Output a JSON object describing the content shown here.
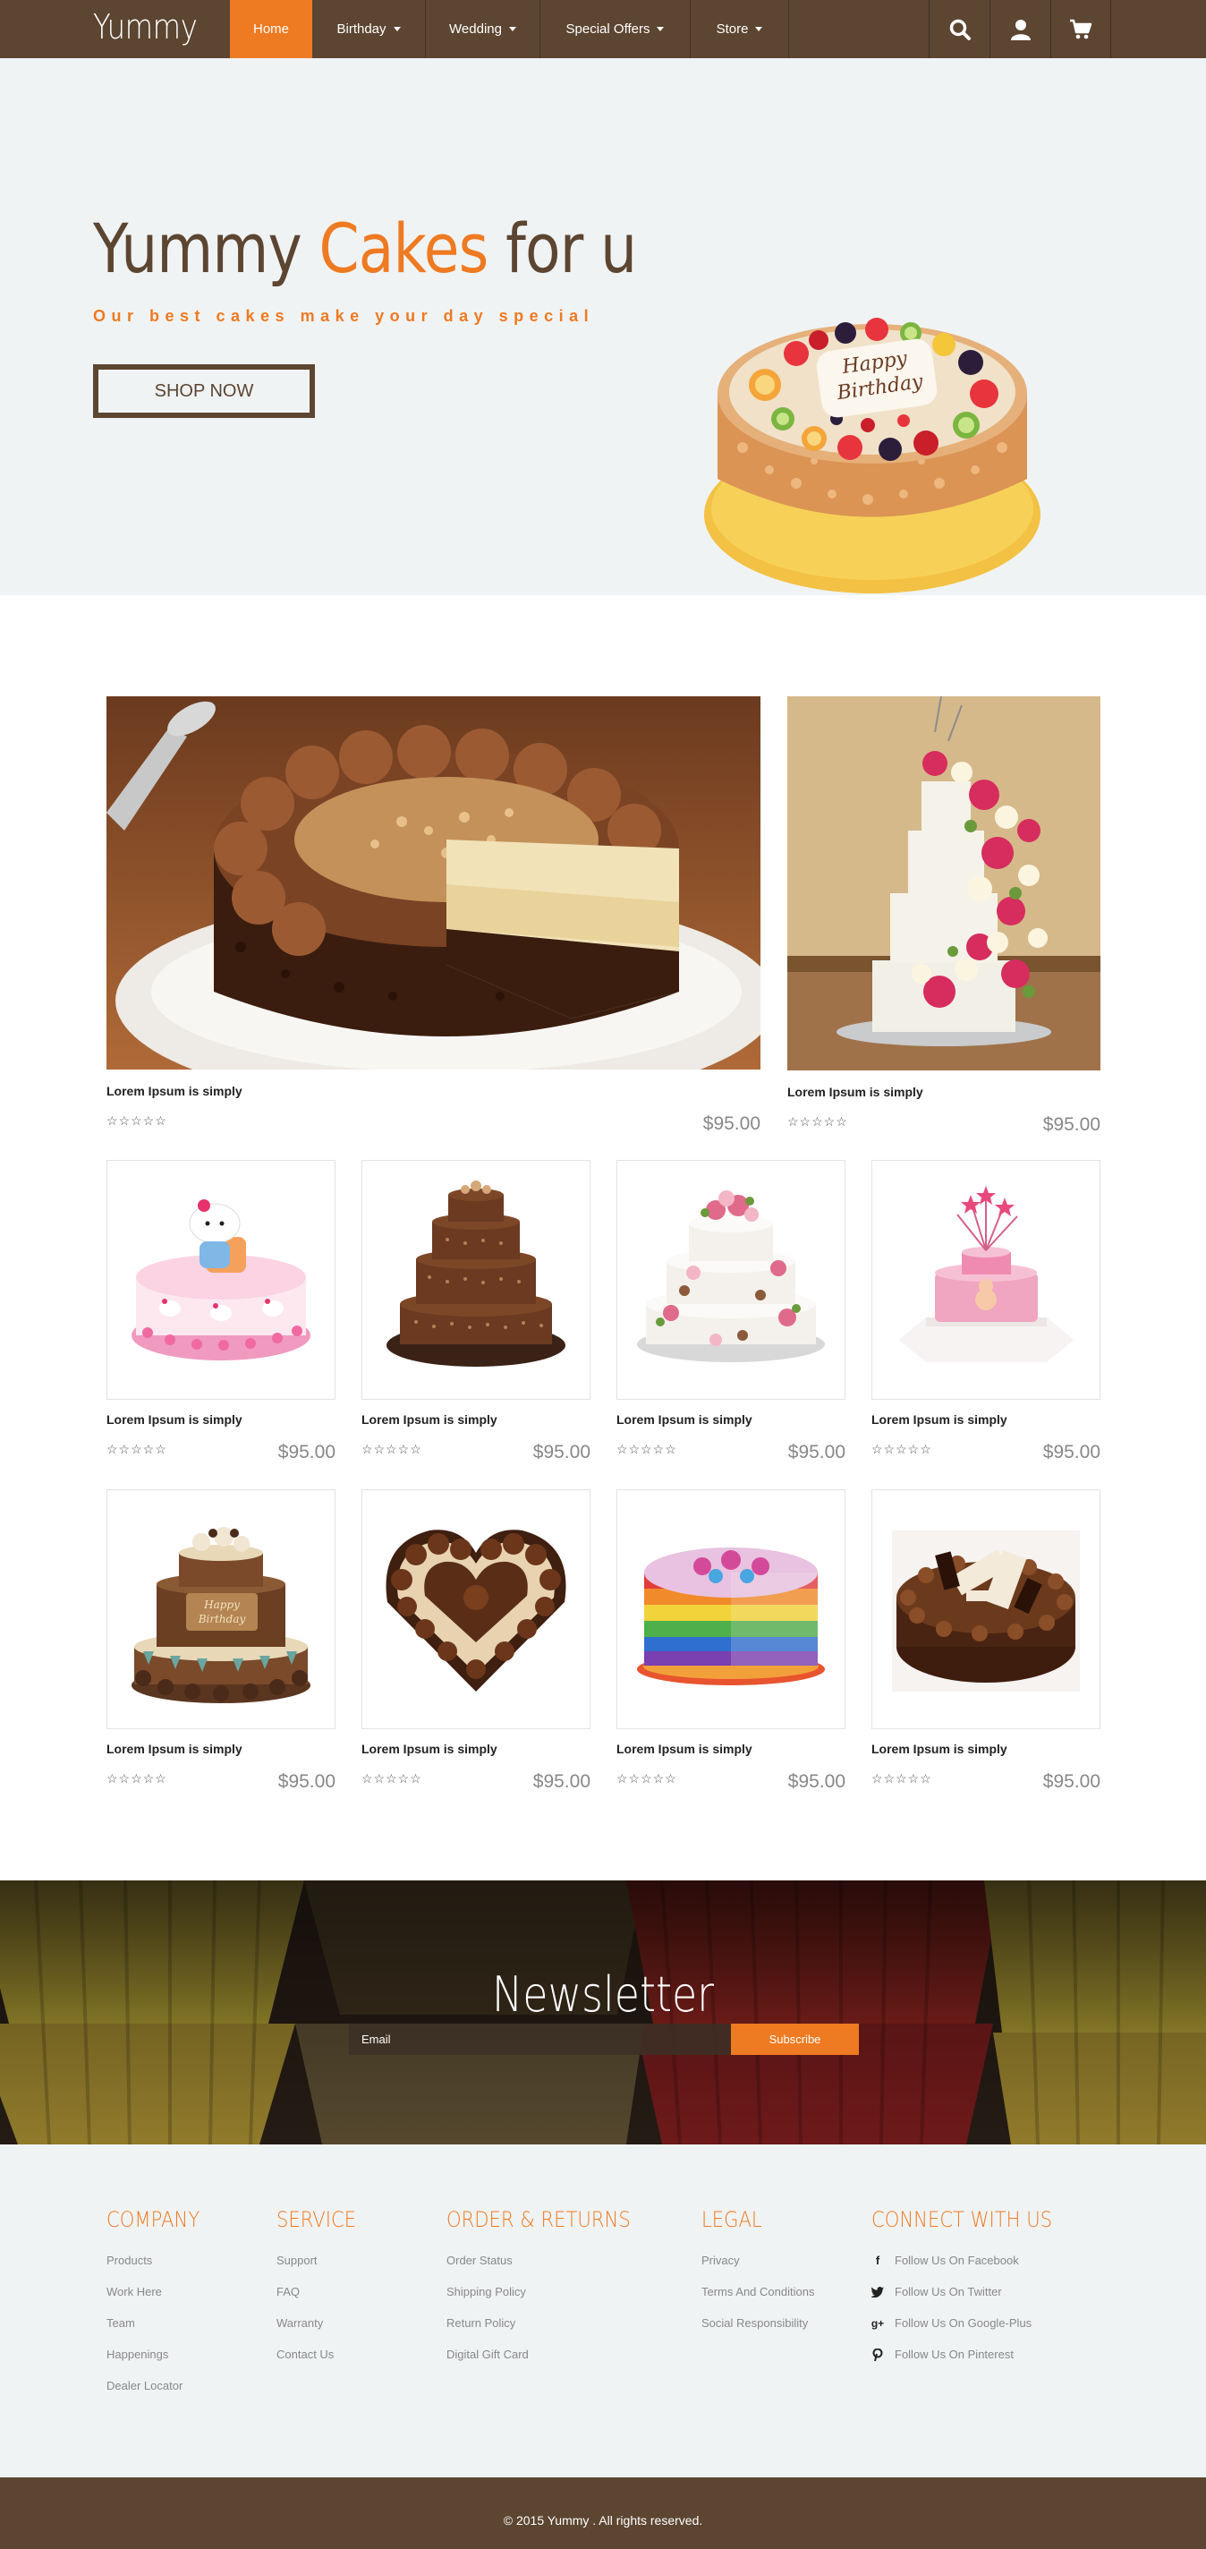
{
  "brand": {
    "logo": "Yummy",
    "accent_color": "#ee7a21",
    "brown": "#5c4531"
  },
  "nav": {
    "items": [
      {
        "label": "Home",
        "active": true
      },
      {
        "label": "Birthday",
        "dropdown": true
      },
      {
        "label": "Wedding",
        "dropdown": true
      },
      {
        "label": "Special Offers",
        "dropdown": true
      },
      {
        "label": "Store",
        "dropdown": true
      }
    ],
    "icons": [
      "search-icon",
      "user-icon",
      "cart-icon"
    ]
  },
  "hero": {
    "title_part1": "Yummy ",
    "title_accent": "Cakes",
    "title_part2": " for u",
    "subtitle": "Our best cakes make your day special",
    "button": "SHOP NOW"
  },
  "products": [
    {
      "name": "Lorem Ipsum is simply",
      "price": "$95.00",
      "stars": "☆☆☆☆☆"
    },
    {
      "name": "Lorem Ipsum is simply",
      "price": "$95.00",
      "stars": "☆☆☆☆☆"
    },
    {
      "name": "Lorem Ipsum is simply",
      "price": "$95.00",
      "stars": "☆☆☆☆☆"
    },
    {
      "name": "Lorem Ipsum is simply",
      "price": "$95.00",
      "stars": "☆☆☆☆☆"
    },
    {
      "name": "Lorem Ipsum is simply",
      "price": "$95.00",
      "stars": "☆☆☆☆☆"
    },
    {
      "name": "Lorem Ipsum is simply",
      "price": "$95.00",
      "stars": "☆☆☆☆☆"
    },
    {
      "name": "Lorem Ipsum is simply",
      "price": "$95.00",
      "stars": "☆☆☆☆☆"
    },
    {
      "name": "Lorem Ipsum is simply",
      "price": "$95.00",
      "stars": "☆☆☆☆☆"
    },
    {
      "name": "Lorem Ipsum is simply",
      "price": "$95.00",
      "stars": "☆☆☆☆☆"
    },
    {
      "name": "Lorem Ipsum is simply",
      "price": "$95.00",
      "stars": "☆☆☆☆☆"
    }
  ],
  "newsletter": {
    "title": "Newsletter",
    "email_placeholder": "Email",
    "button": "Subscribe"
  },
  "footer": {
    "company": {
      "heading": "COMPANY",
      "links": [
        "Products",
        "Work Here",
        "Team",
        "Happenings",
        "Dealer Locator"
      ]
    },
    "service": {
      "heading": "SERVICE",
      "links": [
        "Support",
        "FAQ",
        "Warranty",
        "Contact Us"
      ]
    },
    "orders": {
      "heading": "ORDER & RETURNS",
      "links": [
        "Order Status",
        "Shipping Policy",
        "Return Policy",
        "Digital Gift Card"
      ]
    },
    "legal": {
      "heading": "LEGAL",
      "links": [
        "Privacy",
        "Terms And Conditions",
        "Social Responsibility"
      ]
    },
    "connect": {
      "heading": "CONNECT WITH US",
      "links": [
        {
          "icon": "facebook-icon",
          "label": "Follow Us On Facebook"
        },
        {
          "icon": "twitter-icon",
          "label": "Follow Us On Twitter"
        },
        {
          "icon": "google-plus-icon",
          "label": "Follow Us On Google-Plus"
        },
        {
          "icon": "pinterest-icon",
          "label": "Follow Us On Pinterest"
        }
      ]
    },
    "copyright": "© 2015 Yummy . All rights reserved."
  }
}
